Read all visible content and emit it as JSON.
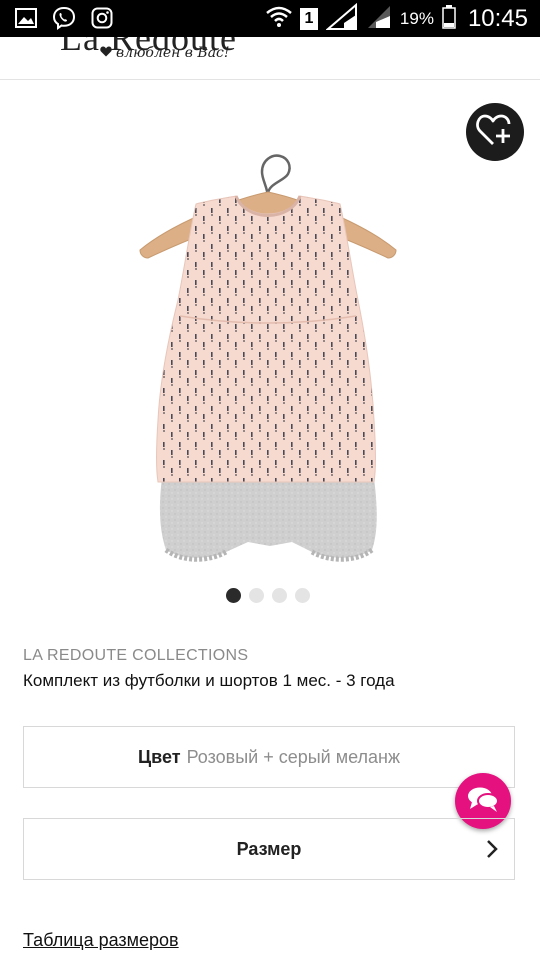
{
  "status_bar": {
    "battery": "19%",
    "time": "10:45",
    "sim_slot": "1"
  },
  "header": {
    "logo": "La Redoute",
    "tagline": "влюблен в Вас!"
  },
  "product": {
    "brand": "LA REDOUTE COLLECTIONS",
    "title": "Комплект из футболки и шортов 1 мес. - 3 года",
    "image_count": 4,
    "active_image": 1
  },
  "color": {
    "label": "Цвет",
    "value": "Розовый + серый меланж"
  },
  "size": {
    "label": "Размер"
  },
  "size_table_link": "Таблица размеров",
  "colors": {
    "chat_accent": "#e4117f",
    "wishlist_bg": "#1c1c1c"
  },
  "icons": [
    "gallery-icon",
    "viber-icon",
    "instagram-icon",
    "wifi-icon",
    "signal-icon",
    "battery-icon",
    "heart-plus-icon",
    "chat-icon",
    "chevron-right-icon"
  ]
}
